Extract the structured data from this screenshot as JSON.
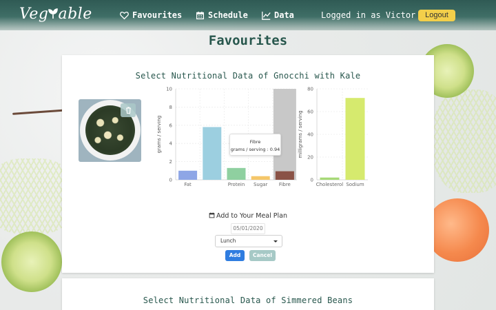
{
  "brand": {
    "name_left": "Veg",
    "name_right": "able"
  },
  "nav": {
    "favourites": "Favourites",
    "schedule": "Schedule",
    "data": "Data",
    "login_text": "Logged in as Victor",
    "logout": "Logout"
  },
  "page": {
    "title": "Favourites"
  },
  "card1": {
    "title": "Select Nutritional Data of Gnocchi with Kale",
    "plan_label": "Add to Your Meal Plan",
    "date_value": "05/01/2020",
    "meal_selected": "Lunch",
    "add": "Add",
    "cancel": "Cancel",
    "tooltip": {
      "title": "Fibre",
      "body": "grams / serving : 0.94"
    }
  },
  "card2": {
    "title": "Select Nutritional Data of Simmered Beans"
  },
  "chart_data": [
    {
      "type": "bar",
      "ylabel": "grams / serving",
      "ylim": [
        0,
        10
      ],
      "yticks": [
        "0",
        "2",
        "4",
        "6",
        "8",
        "10"
      ],
      "categories": [
        "Fat",
        "",
        "Protein",
        "Sugar",
        "Fibre"
      ],
      "values": [
        1.0,
        5.8,
        1.3,
        0.4,
        0.94
      ],
      "colors": [
        "#8ea6e6",
        "#9ccfe0",
        "#8fd0a0",
        "#f5c76a",
        "#8a5246"
      ],
      "highlight_index": 4
    },
    {
      "type": "bar",
      "ylabel": "milligrams / serving",
      "ylim": [
        0,
        80
      ],
      "yticks": [
        "0",
        "20",
        "40",
        "60",
        "80"
      ],
      "categories": [
        "Cholesterol",
        "Sodium"
      ],
      "values": [
        2,
        72
      ],
      "colors": [
        "#a7d977",
        "#d6ea6e"
      ]
    }
  ]
}
